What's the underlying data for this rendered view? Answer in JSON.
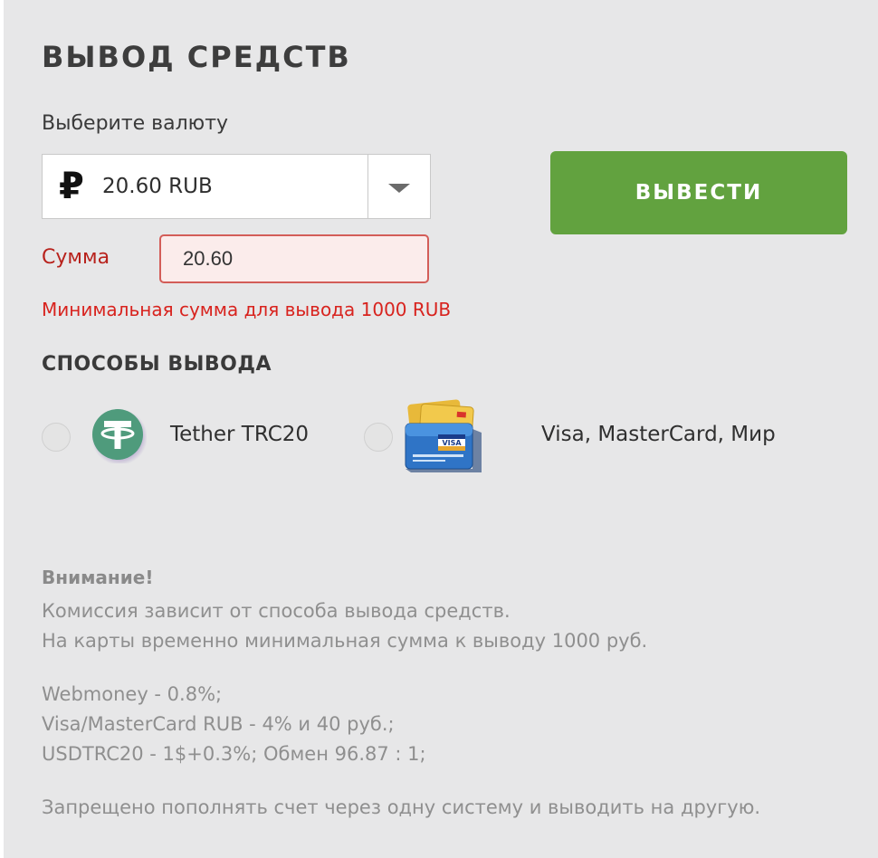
{
  "page": {
    "title": "ВЫВОД СРЕДСТВ"
  },
  "currency": {
    "label": "Выберите валюту",
    "symbol": "₽",
    "selected": "20.60 RUB",
    "arrow_icon": "chevron-down-icon"
  },
  "withdraw_button": {
    "label": "ВЫВЕСТИ",
    "color": "#62a23f"
  },
  "amount": {
    "label": "Сумма",
    "value": "20.60",
    "error": "Минимальная сумма для вывода 1000 RUB",
    "error_color": "#d8231e"
  },
  "methods": {
    "title": "СПОСОБЫ ВЫВОДА",
    "items": [
      {
        "label": "Tether TRC20",
        "icon": "tether-icon",
        "selected": false
      },
      {
        "label": "Visa, MasterCard, Мир",
        "icon": "bank-cards-icon",
        "selected": false
      }
    ]
  },
  "notice": {
    "heading": "Внимание!",
    "lines": [
      "Комиссия зависит от способа вывода средств.",
      "На карты временно минимальная сумма к выводу 1000 руб.",
      "Webmoney - 0.8%;",
      "Visa/MasterCard RUB - 4% и 40 руб.;",
      "USDTRC20 - 1$+0.3%; Обмен 96.87 : 1;",
      "Запрещено пополнять счет через одну систему и выводить на другую."
    ]
  }
}
